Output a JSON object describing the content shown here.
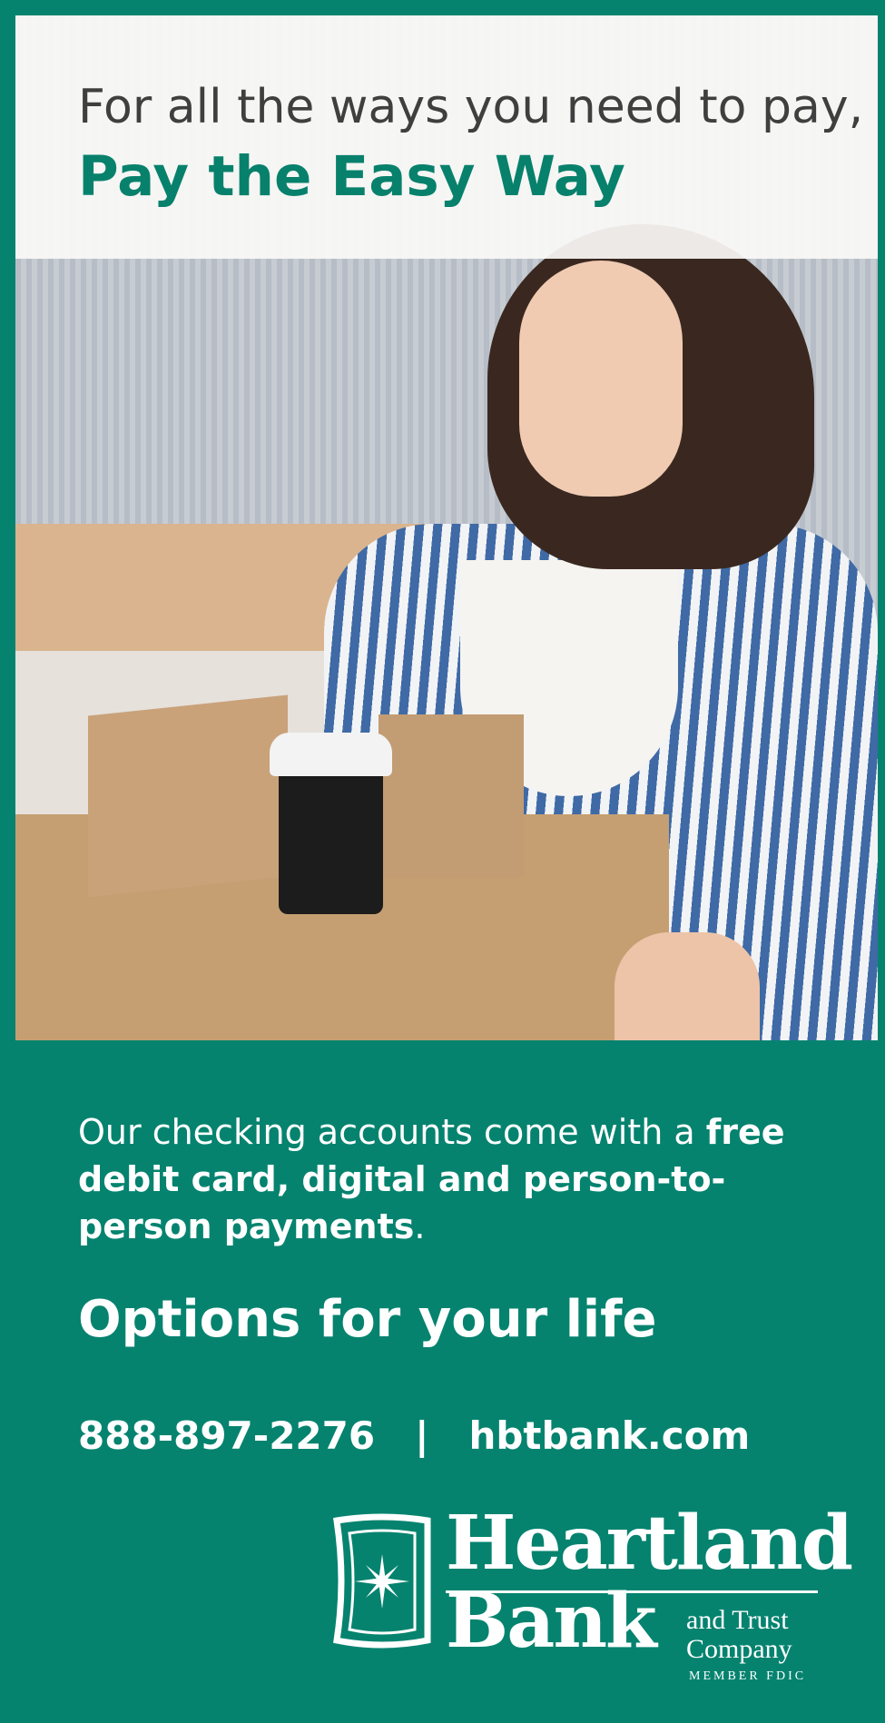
{
  "header": {
    "tagline": "For all the ways you need to pay,",
    "headline": "Pay the Easy Way"
  },
  "photo": {
    "icon": "woman-holding-boxes-photo"
  },
  "body": {
    "text_regular": "Our checking accounts come with a ",
    "text_bold": "free debit card, digital and person-to-person payments",
    "text_end": ".",
    "options": "Options for your life"
  },
  "contact": {
    "phone": "888-897-2276",
    "separator": "|",
    "website": "hbtbank.com"
  },
  "logo": {
    "line1": "Heartland",
    "line2": "Bank",
    "line3": "and Trust Company",
    "fdic": "MEMBER FDIC",
    "icon": "star-shield-icon"
  },
  "colors": {
    "brand_green": "#07816c",
    "text_dark": "#3f3f3f",
    "white": "#ffffff"
  }
}
